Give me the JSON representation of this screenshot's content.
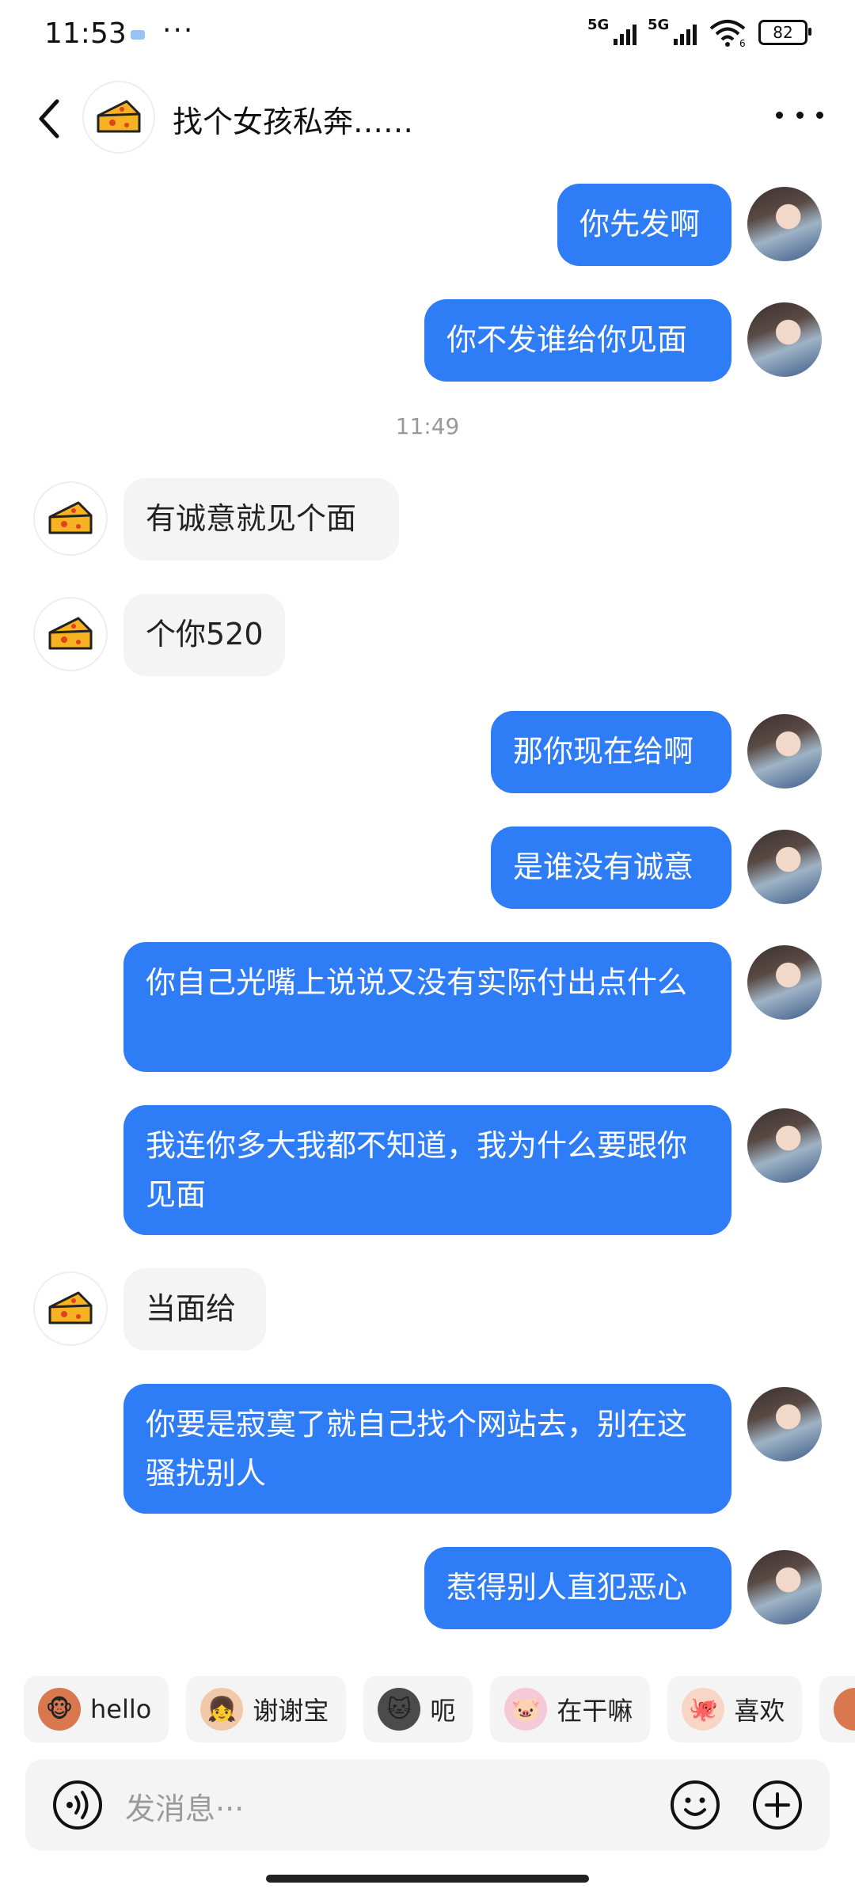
{
  "status_bar": {
    "time": "11:53",
    "dots": "···",
    "signal1_label": "5G",
    "signal2_label": "5G",
    "wifi_label": "6",
    "battery": "82"
  },
  "header": {
    "title": "找个女孩私奔……",
    "back_icon": "chevron-left-icon",
    "more_icon": "more-icon"
  },
  "timestamp": "11:49",
  "messages": [
    {
      "side": "out",
      "text": "你先发啊"
    },
    {
      "side": "out",
      "text": "你不发谁给你见面"
    },
    {
      "side": "in",
      "text": "有诚意就见个面"
    },
    {
      "side": "in",
      "text": "个你520"
    },
    {
      "side": "out",
      "text": "那你现在给啊"
    },
    {
      "side": "out",
      "text": "是谁没有诚意"
    },
    {
      "side": "out",
      "text": "你自己光嘴上说说又没有实际付出点什么"
    },
    {
      "side": "out",
      "text": "我连你多大我都不知道，我为什么要跟你见面"
    },
    {
      "side": "in",
      "text": "当面给"
    },
    {
      "side": "out",
      "text": "你要是寂寞了就自己找个网站去，别在这骚扰别人"
    },
    {
      "side": "out",
      "text": "惹得别人直犯恶心"
    }
  ],
  "quick_replies": [
    {
      "label": "hello",
      "icon": "monkey-emoji-icon"
    },
    {
      "label": "谢谢宝",
      "icon": "girl-emoji-icon"
    },
    {
      "label": "呃",
      "icon": "cat-emoji-icon"
    },
    {
      "label": "在干嘛",
      "icon": "pig-emoji-icon"
    },
    {
      "label": "喜欢",
      "icon": "octopus-emoji-icon"
    }
  ],
  "input": {
    "placeholder": "发消息···"
  },
  "colors": {
    "outgoing_bubble": "#2e7cf6",
    "incoming_bubble": "#f4f4f4"
  }
}
